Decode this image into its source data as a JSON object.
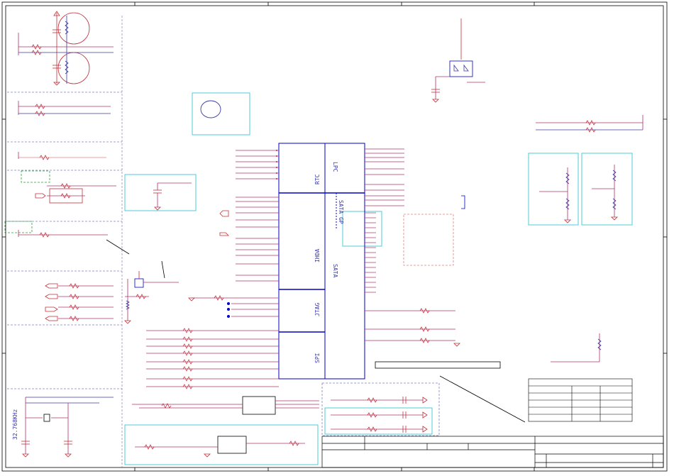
{
  "sheet": {
    "colors": {
      "border": "#000000",
      "wire": "#b0306a",
      "blue_wire": "#3a3aa8",
      "symbol": "#c0303a",
      "block": "#0000c8",
      "cyan_box": "#39c6d6",
      "dashed": "#8080c0",
      "green_box": "#2a9a3a",
      "pink_box": "#e08080"
    },
    "main_ic": {
      "sections": [
        "RTC",
        "IHDA",
        "JTAG",
        "SPI"
      ],
      "right_sections": [
        "LPC",
        "SATA",
        "SATA GP"
      ]
    },
    "crystal_label": "32.768KHz",
    "title_block": {
      "rev_table_rows": 6
    }
  }
}
